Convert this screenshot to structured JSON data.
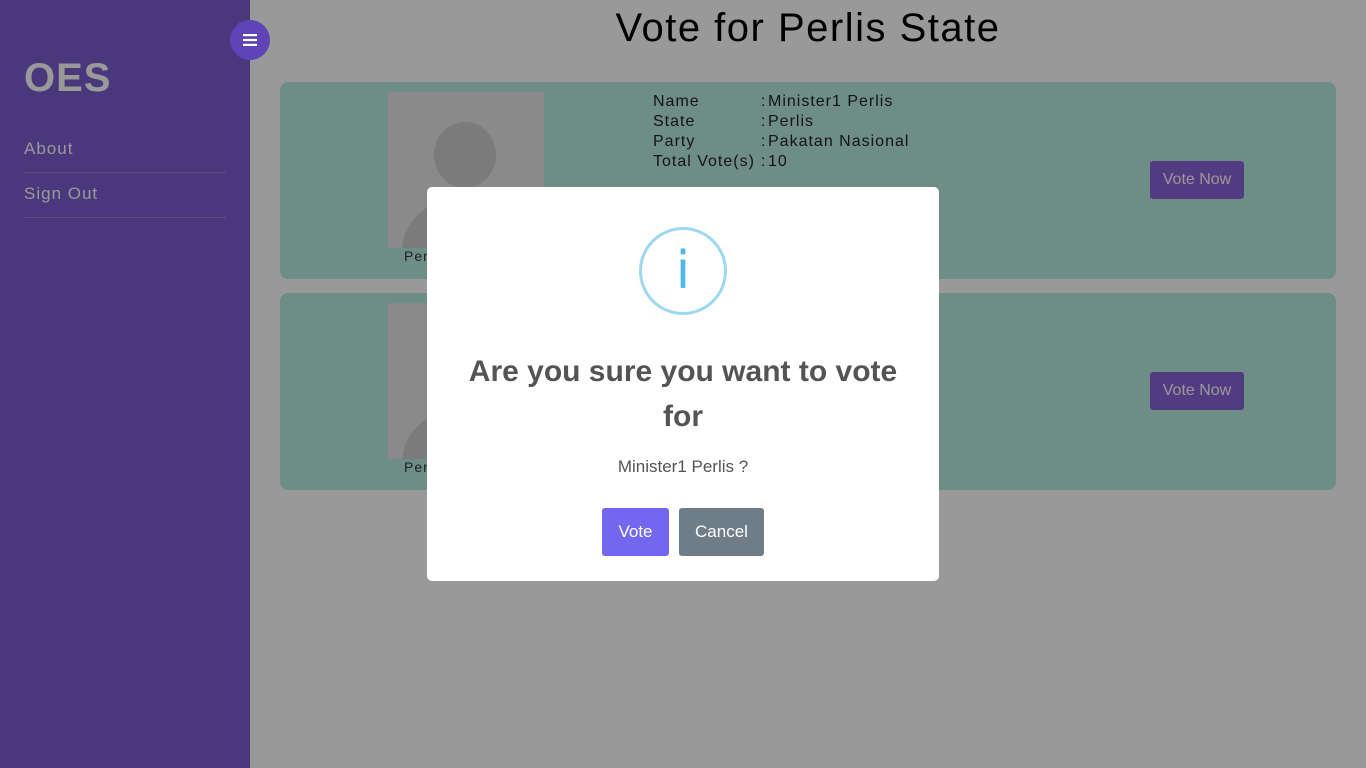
{
  "sidebar": {
    "brand": "OES",
    "items": [
      {
        "label": "About"
      },
      {
        "label": "Sign  Out"
      }
    ]
  },
  "page": {
    "title": "Vote  for  Perlis  State"
  },
  "fields": {
    "name": "Name",
    "state": "State",
    "party": "Party",
    "total_votes": "Total  Vote(s)",
    "separator": ":"
  },
  "candidates": [
    {
      "caption": "Per",
      "name": "Minister1  Perlis",
      "state": "Perlis",
      "party": "Pakatan  Nasional",
      "total_votes": "10",
      "vote_label": "Vote Now"
    },
    {
      "caption": "Per",
      "vote_label": "Vote Now"
    }
  ],
  "modal": {
    "icon": "info-icon",
    "icon_glyph": "i",
    "title": "Are you sure you want to vote for",
    "text": "Minister1 Perlis ?",
    "confirm_label": "Vote",
    "cancel_label": "Cancel"
  },
  "colors": {
    "sidebar": "#7b5fcf",
    "card": "#b7ecdf",
    "vote_button": "#7367f0",
    "cancel_button": "#6e7d88",
    "info_icon": "#4fb8e8"
  }
}
